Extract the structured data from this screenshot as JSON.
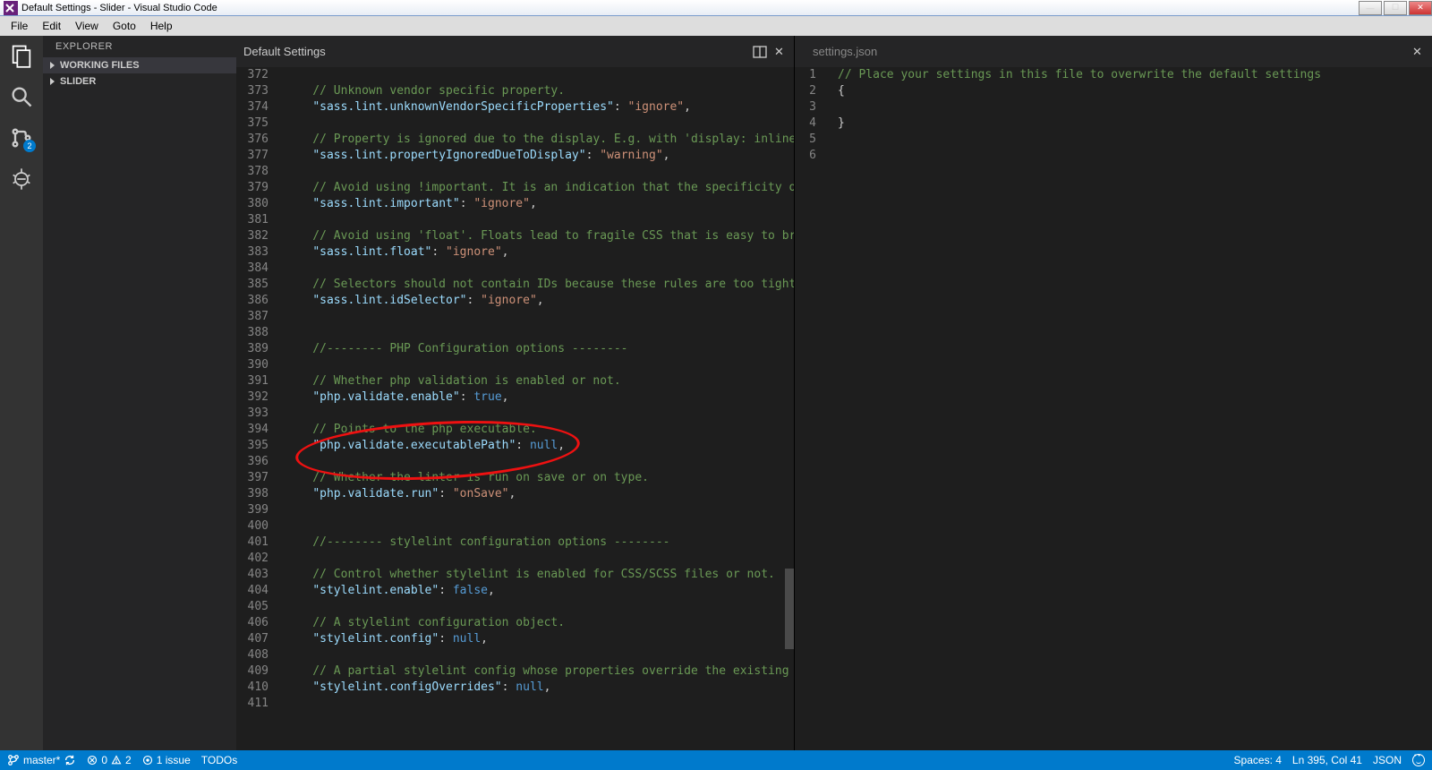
{
  "window": {
    "title": "Default Settings - Slider - Visual Studio Code"
  },
  "menubar": [
    "File",
    "Edit",
    "View",
    "Goto",
    "Help"
  ],
  "sidebar": {
    "title": "EXPLORER",
    "sections": [
      "WORKING FILES",
      "SLIDER"
    ]
  },
  "activity": {
    "badge": "2"
  },
  "tabs": {
    "left": "Default Settings",
    "right": "settings.json"
  },
  "left_lines": [
    {
      "n": 372,
      "t": ""
    },
    {
      "n": 373,
      "t": "comment",
      "c": "    // Unknown vendor specific property."
    },
    {
      "n": 374,
      "t": "setting",
      "k": "sass.lint.unknownVendorSpecificProperties",
      "v": "\"ignore\""
    },
    {
      "n": 375,
      "t": ""
    },
    {
      "n": 376,
      "t": "comment",
      "c": "    // Property is ignored due to the display. E.g. with 'display: inline', t"
    },
    {
      "n": 377,
      "t": "setting",
      "k": "sass.lint.propertyIgnoredDueToDisplay",
      "v": "\"warning\""
    },
    {
      "n": 378,
      "t": ""
    },
    {
      "n": 379,
      "t": "comment",
      "c": "    // Avoid using !important. It is an indication that the specificity of th"
    },
    {
      "n": 380,
      "t": "setting",
      "k": "sass.lint.important",
      "v": "\"ignore\""
    },
    {
      "n": 381,
      "t": ""
    },
    {
      "n": 382,
      "t": "comment",
      "c": "    // Avoid using 'float'. Floats lead to fragile CSS that is easy to break "
    },
    {
      "n": 383,
      "t": "setting",
      "k": "sass.lint.float",
      "v": "\"ignore\""
    },
    {
      "n": 384,
      "t": ""
    },
    {
      "n": 385,
      "t": "comment",
      "c": "    // Selectors should not contain IDs because these rules are too tightly c"
    },
    {
      "n": 386,
      "t": "setting",
      "k": "sass.lint.idSelector",
      "v": "\"ignore\""
    },
    {
      "n": 387,
      "t": ""
    },
    {
      "n": 388,
      "t": ""
    },
    {
      "n": 389,
      "t": "comment",
      "c": "    //-------- PHP Configuration options --------"
    },
    {
      "n": 390,
      "t": ""
    },
    {
      "n": 391,
      "t": "comment",
      "c": "    // Whether php validation is enabled or not."
    },
    {
      "n": 392,
      "t": "setting",
      "k": "php.validate.enable",
      "v": "true",
      "kw": true
    },
    {
      "n": 393,
      "t": ""
    },
    {
      "n": 394,
      "t": "comment",
      "c": "    // Points to the php executable."
    },
    {
      "n": 395,
      "t": "setting",
      "k": "php.validate.executablePath",
      "v": "null",
      "kw": true
    },
    {
      "n": 396,
      "t": ""
    },
    {
      "n": 397,
      "t": "comment",
      "c": "    // Whether the linter is run on save or on type."
    },
    {
      "n": 398,
      "t": "setting",
      "k": "php.validate.run",
      "v": "\"onSave\""
    },
    {
      "n": 399,
      "t": ""
    },
    {
      "n": 400,
      "t": ""
    },
    {
      "n": 401,
      "t": "comment",
      "c": "    //-------- stylelint configuration options --------"
    },
    {
      "n": 402,
      "t": ""
    },
    {
      "n": 403,
      "t": "comment",
      "c": "    // Control whether stylelint is enabled for CSS/SCSS files or not."
    },
    {
      "n": 404,
      "t": "setting",
      "k": "stylelint.enable",
      "v": "false",
      "kw": true
    },
    {
      "n": 405,
      "t": ""
    },
    {
      "n": 406,
      "t": "comment",
      "c": "    // A stylelint configuration object."
    },
    {
      "n": 407,
      "t": "setting",
      "k": "stylelint.config",
      "v": "null",
      "kw": true
    },
    {
      "n": 408,
      "t": ""
    },
    {
      "n": 409,
      "t": "comment",
      "c": "    // A partial stylelint config whose properties override the existing ones"
    },
    {
      "n": 410,
      "t": "setting",
      "k": "stylelint.configOverrides",
      "v": "null",
      "kw": true
    },
    {
      "n": 411,
      "t": ""
    }
  ],
  "right_lines": [
    {
      "n": 1,
      "html": "<span class='tk-comment'>// Place your settings in this file to overwrite the default settings</span>"
    },
    {
      "n": 2,
      "html": "<span class='tk-punc'>{</span>"
    },
    {
      "n": 3,
      "html": ""
    },
    {
      "n": 4,
      "html": "<span class='tk-punc'>}</span>"
    },
    {
      "n": 5,
      "html": ""
    },
    {
      "n": 6,
      "html": ""
    }
  ],
  "status": {
    "branch": "master*",
    "errors": "0",
    "warnings": "2",
    "issues": "1 issue",
    "todos": "TODOs",
    "spaces": "Spaces: 4",
    "pos": "Ln 395, Col 41",
    "lang": "JSON"
  }
}
